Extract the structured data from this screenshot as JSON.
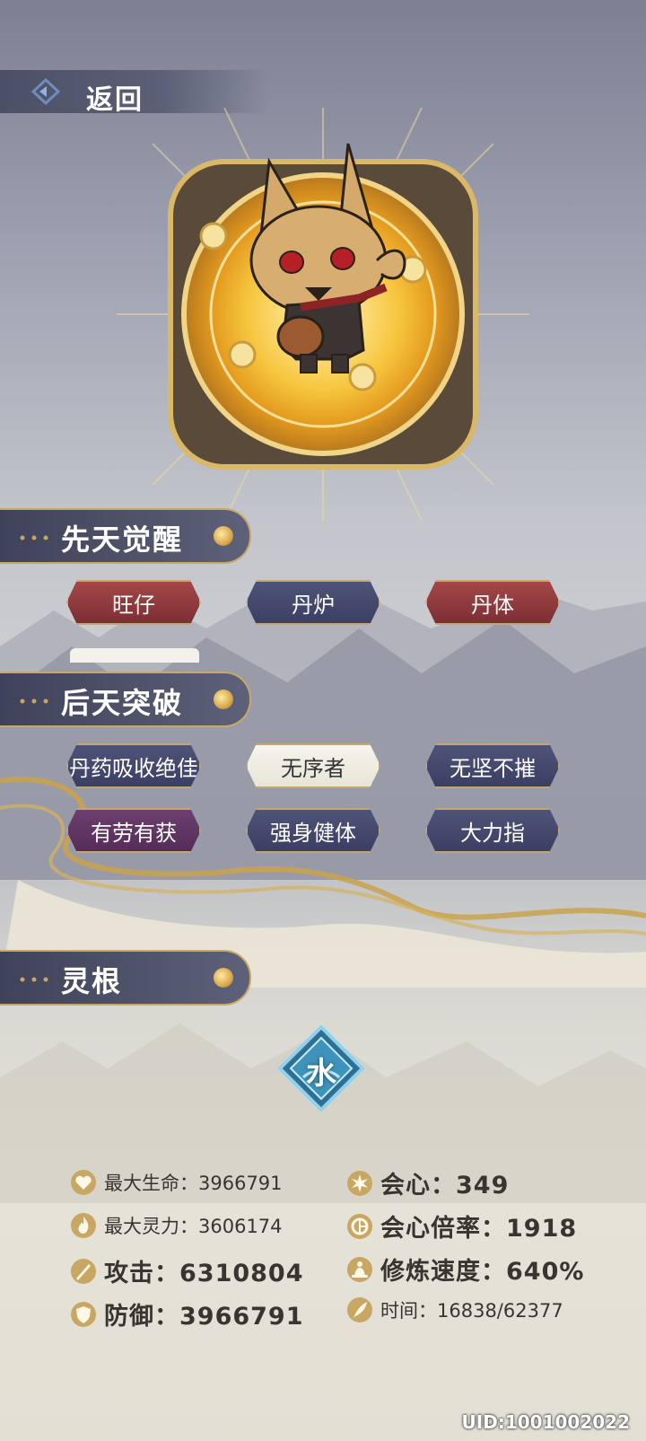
{
  "header": {
    "back_label": "返回"
  },
  "sections": {
    "innate": {
      "title": "先天觉醒",
      "buttons": [
        "旺仔",
        "丹炉",
        "丹体"
      ]
    },
    "acquired": {
      "title": "后天突破",
      "buttons": [
        "丹药吸收绝佳",
        "无序者",
        "无坚不摧",
        "有劳有获",
        "强身健体",
        "大力指"
      ]
    },
    "spirit_root": {
      "title": "灵根",
      "element": "水"
    }
  },
  "stats": {
    "max_hp": "最大生命：3966791",
    "max_mp": "最大灵力：3606174",
    "attack": "攻击：6310804",
    "defense": "防御：3966791",
    "crit": "会心：349",
    "crit_rate": "会心倍率：1918",
    "cultivation_speed": "修炼速度：640%",
    "time": "时间：16838/62377"
  },
  "footer": {
    "uid": "UID:1001002022"
  },
  "colors": {
    "gold": "#c6a66a",
    "red": "#8e3a3e",
    "navy": "#43476a",
    "purple": "#5f3462"
  }
}
